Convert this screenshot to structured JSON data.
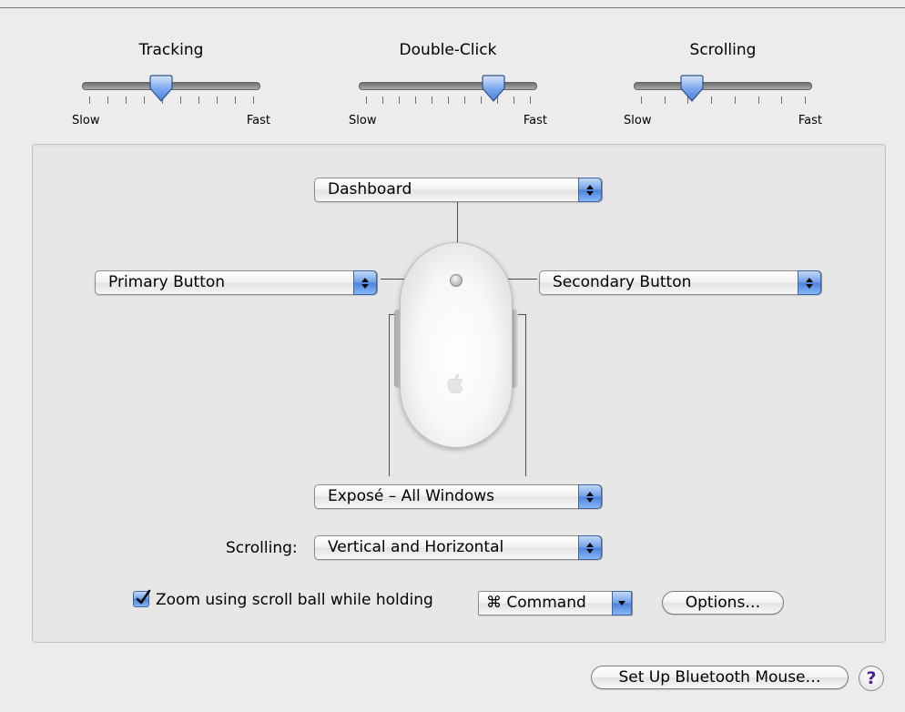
{
  "sliders": {
    "tracking": {
      "title": "Tracking",
      "min_label": "Slow",
      "max_label": "Fast",
      "ticks": 10,
      "value_fraction": 0.44
    },
    "double_click": {
      "title": "Double-Click",
      "min_label": "Slow",
      "max_label": "Fast",
      "ticks": 11,
      "value_fraction": 0.78
    },
    "scrolling": {
      "title": "Scrolling",
      "min_label": "Slow",
      "max_label": "Fast",
      "ticks": 8,
      "value_fraction": 0.31
    }
  },
  "buttons_mapping": {
    "top": "Dashboard",
    "left": "Primary Button",
    "right": "Secondary Button",
    "side": "Exposé – All Windows"
  },
  "scrolling_option": {
    "label": "Scrolling:",
    "value": "Vertical and Horizontal"
  },
  "zoom": {
    "checked": true,
    "label": "Zoom using scroll ball while holding",
    "modifier": "⌘ Command"
  },
  "options_button": "Options…",
  "setup_button": "Set Up Bluetooth Mouse…",
  "help_button": "?",
  "colors": {
    "accent": "#5b8fe3",
    "background": "#ececec",
    "panel": "#e7e7e7"
  },
  "icons": {
    "mouse": "apple-mighty-mouse-icon",
    "help": "help-icon",
    "checkbox": "checkmark-icon"
  }
}
